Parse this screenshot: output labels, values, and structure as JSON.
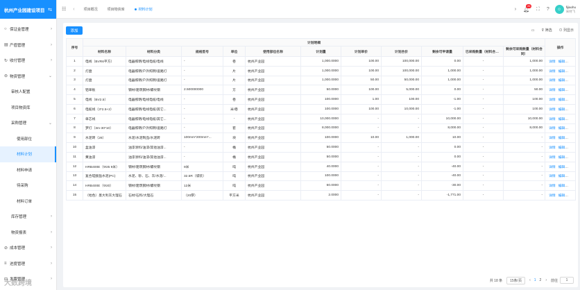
{
  "brand": {
    "title": "杭州产业园建设项目"
  },
  "sidebar": {
    "items": [
      {
        "label": "保证金管理",
        "icon": "○",
        "level": 0,
        "arrow": "›"
      },
      {
        "label": "产值管理",
        "icon": "▤",
        "level": 0,
        "arrow": "›"
      },
      {
        "label": "收付管理",
        "icon": "↻",
        "level": 0,
        "arrow": "›"
      },
      {
        "label": "物资管理",
        "icon": "⊜",
        "level": 0,
        "arrow": "⌄"
      },
      {
        "label": "审核人配置",
        "icon": "",
        "level": 1,
        "arrow": ""
      },
      {
        "label": "项目物资库",
        "icon": "",
        "level": 1,
        "arrow": ""
      },
      {
        "label": "采购管理",
        "icon": "",
        "level": 1,
        "arrow": "⌄"
      },
      {
        "label": "使用部位",
        "icon": "",
        "level": 2,
        "arrow": ""
      },
      {
        "label": "材料计划",
        "icon": "",
        "level": 2,
        "arrow": "",
        "active": true
      },
      {
        "label": "材料申请",
        "icon": "",
        "level": 2,
        "arrow": ""
      },
      {
        "label": "待采购",
        "icon": "",
        "level": 2,
        "arrow": ""
      },
      {
        "label": "材料订单",
        "icon": "",
        "level": 2,
        "arrow": ""
      },
      {
        "label": "库存管理",
        "icon": "",
        "level": 1,
        "arrow": "›"
      },
      {
        "label": "物资报表",
        "icon": "",
        "level": 1,
        "arrow": "›"
      },
      {
        "label": "成本管理",
        "icon": "⊘",
        "level": 0,
        "arrow": "›"
      },
      {
        "label": "进度管理",
        "icon": "≡",
        "level": 0,
        "arrow": "›"
      },
      {
        "label": "发票管理",
        "icon": "⊟",
        "level": 0,
        "arrow": "›"
      },
      {
        "label": "设置管理",
        "icon": "⚙",
        "level": 0,
        "arrow": ""
      }
    ]
  },
  "header": {
    "tabs": [
      {
        "label": "项目概况",
        "active": false
      },
      {
        "label": "项目物资库",
        "active": false
      },
      {
        "label": "材料计划",
        "active": true
      }
    ],
    "notify_count": "26",
    "user_name": "fijiaohu",
    "user_dept": "采材飞"
  },
  "toolbar": {
    "add_label": "添加",
    "filter_label": "筛选",
    "columns_label": "列显示"
  },
  "table": {
    "group_header": "计划明细",
    "col_index": "序号",
    "col_ops": "操作",
    "columns": [
      "材料名称",
      "材料分类",
      "规格型号",
      "单位",
      "使用部位名称",
      "计划量",
      "计划单价",
      "计划合价",
      "剩余可申请量",
      "已采购数量（材料合同）",
      "剩余可采购数量（材料合同）"
    ],
    "ops": [
      "详情",
      "编辑",
      "删除"
    ],
    "rows": [
      [
        "1",
        "电线（BVR6平方）",
        "电器照明/电线电缆/电线",
        "-",
        "卷",
        "杭州产业园",
        "1,000.0000",
        "100.00",
        "100,000.00",
        "0.00",
        "-",
        "1,000.00"
      ],
      [
        "2",
        "灯盘",
        "电器照明/户外照明/道路灯",
        "-",
        "片",
        "杭州产业园",
        "1,000.0000",
        "100.00",
        "100,000.00",
        "1,000.00",
        "-",
        "1,000.00"
      ],
      [
        "3",
        "灯盘",
        "电器照明/户外照明/道路灯",
        "-",
        "片",
        "杭州产业园",
        "1,000.0000",
        "50.00",
        "50,000.00",
        "1,000.00",
        "-",
        "1,000.00"
      ],
      [
        "4",
        "铝单板",
        "钢材/建筑钢材/螺纹钢",
        "2.500000000",
        "方",
        "杭州产业园",
        "50.0000",
        "100.00",
        "5,000.00",
        "0.00",
        "-",
        "50.00"
      ],
      [
        "5",
        "电线（BV2.5）",
        "电器照明/电线电缆/电线",
        "-",
        "卷",
        "杭州产业园",
        "100.0000",
        "1.00",
        "100.00",
        "-1.00",
        "-",
        "100.00"
      ],
      [
        "6",
        "电缆线（3*2.5+2）",
        "电器照明/电线电缆/其它...",
        "-",
        "米/卷",
        "杭州产业园",
        "100.0000",
        "100.00",
        "10,000.00",
        "-1.00",
        "-",
        "100.00"
      ],
      [
        "7",
        "单芯线",
        "电器照明/电线电缆/其它...",
        "-",
        "-",
        "杭州产业园",
        "10,000.0000",
        "-",
        "-",
        "10,000.00",
        "-",
        "10,000.00"
      ],
      [
        "8",
        "梦灯（3m-30*10）",
        "电器照明/户外照明/道路灯",
        "-",
        "套",
        "杭州产业园",
        "8,000.0000",
        "-",
        "-",
        "8,000.00",
        "-",
        "8,000.00"
      ],
      [
        "9",
        "水泥砖（26）",
        "水泥/水泥制品/水泥砖",
        "100mm*200mm*...",
        "块",
        "杭州产业园",
        "100.0000",
        "10.00",
        "1,000.00",
        "10.00",
        "-",
        "-"
      ],
      [
        "10",
        "盒油漆",
        "油漆涂料/油漆/其他油漆...",
        "-",
        "桶",
        "杭州产业园",
        "50.0000",
        "-",
        "-",
        "0.00",
        "-",
        "-"
      ],
      [
        "11",
        "黄油漆",
        "油漆涂料/油漆/其他油漆...",
        "-",
        "桶",
        "杭州产业园",
        "50.0000",
        "-",
        "-",
        "0.00",
        "-",
        "-"
      ],
      [
        "12",
        "HRB400E（Φ25 9米）",
        "钢材/建筑钢材/螺纹钢",
        "9米",
        "吨",
        "杭州产业园",
        "40.0000",
        "-",
        "-",
        "-40.00",
        "-",
        "-"
      ],
      [
        "13",
        "复合硅酸盐水泥(PC)",
        "水泥、砂、石、灰/水泥/...",
        "32.5R（袋装）",
        "吨",
        "杭州产业园",
        "100.0000",
        "-",
        "-",
        "-40.00",
        "-",
        "-"
      ],
      [
        "14",
        "HRB400E（Φ20）",
        "钢材/建筑钢材/螺纹钢",
        "12米",
        "吨",
        "杭州产业园",
        "60.0000",
        "-",
        "-",
        "-30.00",
        "-",
        "-"
      ],
      [
        "15",
        "（地色）墨大利灰大理石",
        "石材/石料/大理石",
        "（20厚）",
        "平方米",
        "杭州产业园",
        "2.0000",
        "-",
        "-",
        "-1,771.00",
        "-",
        "-"
      ]
    ]
  },
  "pager": {
    "total": "共 18 条",
    "page_size": "15条/页",
    "pages": [
      "1",
      "2"
    ],
    "current": "1",
    "goto_label": "前往",
    "goto_value": "1",
    "prev": "‹",
    "next": "›"
  },
  "watermark": "大数跨境"
}
